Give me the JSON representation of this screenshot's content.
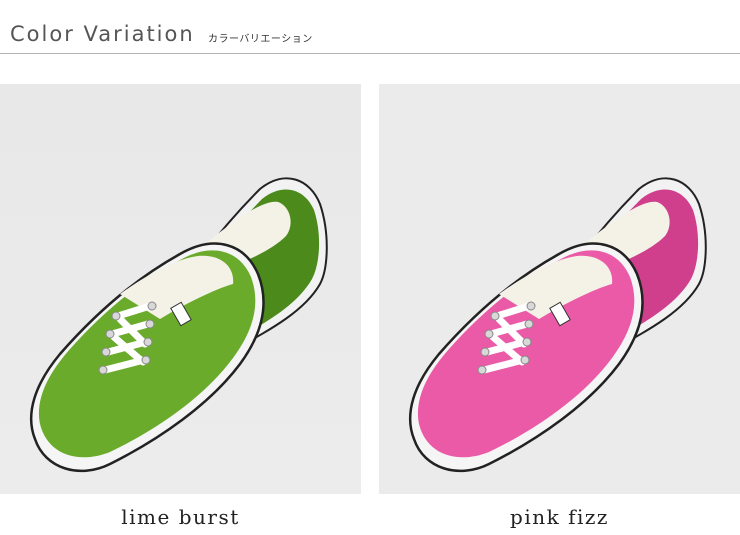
{
  "header": {
    "title": "Color Variation",
    "subtitle": "カラーバリエーション"
  },
  "variants": [
    {
      "name": "lime burst",
      "color": "#6aab2c",
      "color_dark": "#4c8a1c",
      "color_light": "#85c23e"
    },
    {
      "name": "pink fizz",
      "color": "#ea5aa6",
      "color_dark": "#cf3f8c",
      "color_light": "#f37fbd"
    }
  ],
  "icons": [
    "shoe-image-lime",
    "shoe-image-pink"
  ]
}
